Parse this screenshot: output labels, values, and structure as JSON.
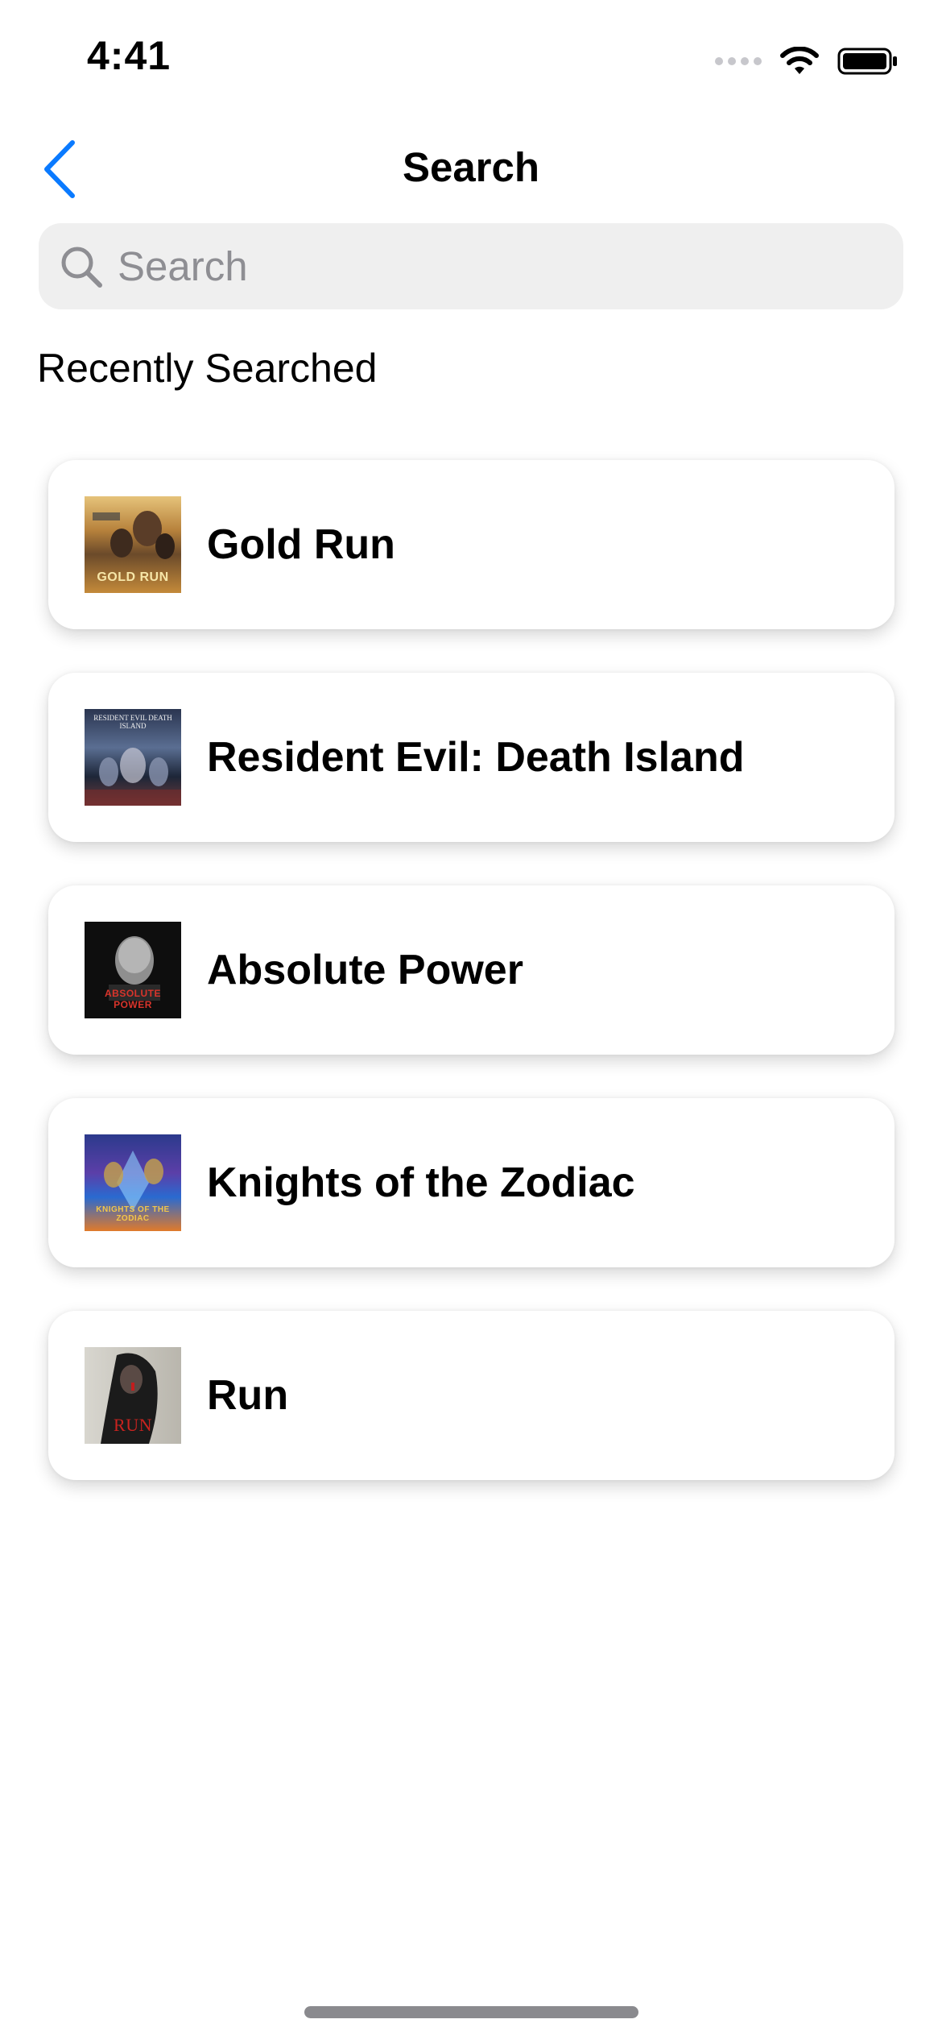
{
  "status_bar": {
    "time": "4:41",
    "icons": [
      "cellular-signal-icon",
      "wifi-icon",
      "battery-icon"
    ]
  },
  "nav": {
    "back_icon": "chevron-left-icon",
    "title": "Search"
  },
  "search": {
    "placeholder": "Search",
    "value": "",
    "icon": "search-icon"
  },
  "recent": {
    "title": "Recently Searched",
    "items": [
      {
        "title": "Gold Run",
        "poster_text": "GOLD RUN"
      },
      {
        "title": "Resident Evil: Death Island",
        "poster_text": "RESIDENT EVIL DEATH ISLAND"
      },
      {
        "title": "Absolute Power",
        "poster_text": "ABSOLUTE POWER"
      },
      {
        "title": "Knights of the Zodiac",
        "poster_text": "KNIGHTS OF THE ZODIAC"
      },
      {
        "title": "Run",
        "poster_text": "RUN"
      }
    ]
  },
  "colors": {
    "accent": "#0a7aff",
    "search_background": "#efefef",
    "placeholder": "#8e8e93",
    "home_indicator": "#8a8a8e"
  }
}
